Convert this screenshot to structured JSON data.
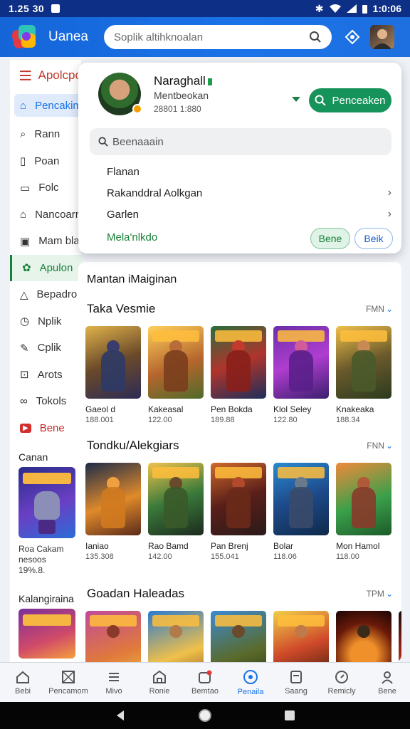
{
  "status_bar": {
    "time_left": "1.25 30",
    "time_right": "1:0:06"
  },
  "app_bar": {
    "app_name": "Uanea",
    "search_placeholder": "Soplik altihknoalan"
  },
  "sidebar": {
    "header": "Apolcpc",
    "items": [
      {
        "label": "Pencakim",
        "icon": "home-icon"
      },
      {
        "label": "Rann",
        "icon": "search-icon"
      },
      {
        "label": "Poan",
        "icon": "bookmark-icon"
      },
      {
        "label": "Folc",
        "icon": "folder-icon"
      },
      {
        "label": "Nancoarr",
        "icon": "store-icon"
      },
      {
        "label": "Mam blacker",
        "icon": "monitor-icon"
      },
      {
        "label": "Apulon",
        "icon": "apps-icon"
      },
      {
        "label": "Bepadro",
        "icon": "bell-icon"
      },
      {
        "label": "Nplik",
        "icon": "clock-icon"
      },
      {
        "label": "Cplik",
        "icon": "pen-icon"
      },
      {
        "label": "Arots",
        "icon": "box-icon"
      },
      {
        "label": "Tokols",
        "icon": "link-icon"
      },
      {
        "label": "Bene",
        "icon": "youtube-icon"
      }
    ],
    "section_label": "Canan",
    "game": {
      "title": "Roa Cakam",
      "line2": "nesoos",
      "line3": "19%.8."
    },
    "section2_label": "Kalangiraina"
  },
  "popup": {
    "user_name": "Naraghall",
    "user_sub": "Mentbeokan",
    "user_meta": "28801 1:880",
    "search_button": "Penceaken",
    "search_placeholder": "Beenaaain",
    "menu": [
      {
        "label": "Flanan",
        "chevron": false
      },
      {
        "label": "Rakanddral Aolkgan",
        "chevron": true
      },
      {
        "label": "Garlen",
        "chevron": true
      }
    ],
    "green_link": "Mela'nlkdo",
    "button_primary": "Bene",
    "button_secondary": "Beik"
  },
  "main": {
    "title": "Mantan iMaiginan",
    "sections": [
      {
        "title": "Taka Vesmie",
        "more_text": "FMN",
        "more_chevron": "⌄",
        "games": [
          {
            "name": "Gaeol d",
            "meta": "188.001"
          },
          {
            "name": "Kakeasal",
            "meta": "122.00"
          },
          {
            "name": "Pen Bokda",
            "meta": "189.88"
          },
          {
            "name": "Klol Seley",
            "meta": "122.80"
          },
          {
            "name": "Knakeaka",
            "meta": "188.34"
          }
        ]
      },
      {
        "title": "Tondku/Alekgiars",
        "more_text": "FNN",
        "more_chevron": "⌄",
        "games": [
          {
            "name": "Ianiao",
            "meta": "135.308"
          },
          {
            "name": "Rao Bamd",
            "meta": "142.00"
          },
          {
            "name": "Pan Brenj",
            "meta": "155.041"
          },
          {
            "name": "Bolar",
            "meta": "118.06"
          },
          {
            "name": "Mon Hamol",
            "meta": "118.00"
          }
        ]
      },
      {
        "title": "Goadan Haleadas",
        "more_text": "TPM",
        "more_chevron": "⌄",
        "games": [
          {
            "name": "",
            "meta": ""
          },
          {
            "name": "",
            "meta": ""
          },
          {
            "name": "",
            "meta": ""
          },
          {
            "name": "",
            "meta": ""
          },
          {
            "name": "",
            "meta": ""
          }
        ]
      }
    ]
  },
  "bottom_nav": [
    {
      "label": "Bebi",
      "icon": "home-icon",
      "active": false
    },
    {
      "label": "Pencamom",
      "icon": "crosshair-icon",
      "active": false
    },
    {
      "label": "Mivo",
      "icon": "list-icon",
      "active": false
    },
    {
      "label": "Ronie",
      "icon": "store-icon",
      "active": false
    },
    {
      "label": "Bemtao",
      "icon": "notification-icon",
      "active": false
    },
    {
      "label": "Penaila",
      "icon": "target-icon",
      "active": true
    },
    {
      "label": "Saang",
      "icon": "tv-icon",
      "active": false
    },
    {
      "label": "Remicly",
      "icon": "compass-icon",
      "active": false
    },
    {
      "label": "Bene",
      "icon": "person-icon",
      "active": false
    }
  ],
  "colors": {
    "accent": "#1a73e8",
    "green": "#188038",
    "appbar": "#1565d8"
  }
}
